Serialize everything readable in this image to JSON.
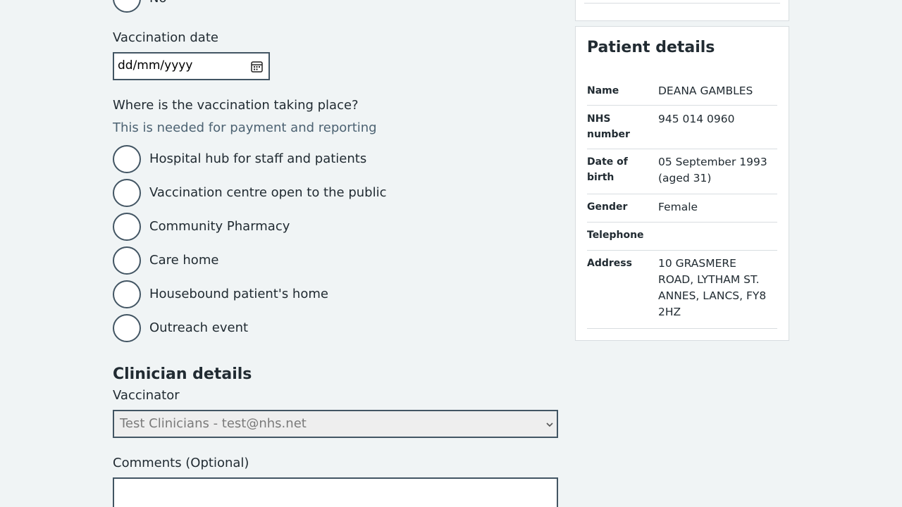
{
  "form": {
    "top_radio_label": "No",
    "vaccination_date": {
      "label": "Vaccination date",
      "placeholder": "dd/mm/yyyy",
      "icon": "calendar-icon"
    },
    "location": {
      "question": "Where is the vaccination taking place?",
      "hint": "This is needed for payment and reporting",
      "options": [
        "Hospital hub for staff and patients",
        "Vaccination centre open to the public",
        "Community Pharmacy",
        "Care home",
        "Housebound patient's home",
        "Outreach event"
      ]
    },
    "clinician": {
      "heading": "Clinician details",
      "vaccinator_label": "Vaccinator",
      "vaccinator_value": "Test Clinicians - test@nhs.net"
    },
    "comments_label": "Comments (Optional)"
  },
  "patient": {
    "title": "Patient details",
    "rows": [
      {
        "key": "Name",
        "value": "DEANA GAMBLES"
      },
      {
        "key": "NHS number",
        "value": "945 014 0960"
      },
      {
        "key": "Date of birth",
        "value": "05 September 1993 (aged 31)"
      },
      {
        "key": "Gender",
        "value": "Female"
      },
      {
        "key": "Telephone",
        "value": ""
      },
      {
        "key": "Address",
        "value": "10 GRASMERE ROAD, LYTHAM ST. ANNES, LANCS, FY8 2HZ"
      }
    ]
  },
  "colors": {
    "background": "#f0f4f5",
    "text": "#212b32",
    "hint": "#4c6272",
    "border": "#425563"
  }
}
